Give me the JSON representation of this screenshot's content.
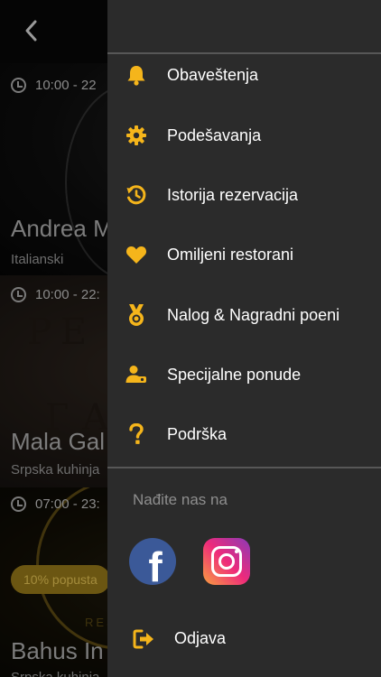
{
  "colors": {
    "accent": "#f5b51b",
    "drawer_bg": "#2b2b2b",
    "text": "#ffffff",
    "muted": "#8e8e8e"
  },
  "background": {
    "restaurants": [
      {
        "hours": "10:00 - 22",
        "name": "Andrea M",
        "category": "Italianski"
      },
      {
        "hours": "10:00 - 22:",
        "name": "Mala Gal",
        "category": "Srpska kuhinja"
      },
      {
        "hours": "07:00 - 23:",
        "name": "Bahus In",
        "category": "Srpska kuhinja",
        "badge": "10% popusta"
      }
    ],
    "back_icon": "chevron-left-icon"
  },
  "menu": {
    "items": [
      {
        "label": "Obaveštenja",
        "icon": "bell-icon"
      },
      {
        "label": "Podešavanja",
        "icon": "gear-icon"
      },
      {
        "label": "Istorija rezervacija",
        "icon": "history-icon"
      },
      {
        "label": "Omiljeni restorani",
        "icon": "heart-icon"
      },
      {
        "label": "Nalog & Nagradni poeni",
        "icon": "medal-icon"
      },
      {
        "label": "Specijalne ponude",
        "icon": "user-offer-icon"
      },
      {
        "label": "Podrška",
        "icon": "question-icon"
      }
    ],
    "find_us": "Nađite nas na",
    "social": [
      {
        "icon": "facebook-icon"
      },
      {
        "icon": "instagram-icon"
      }
    ],
    "logout_label": "Odjava"
  }
}
